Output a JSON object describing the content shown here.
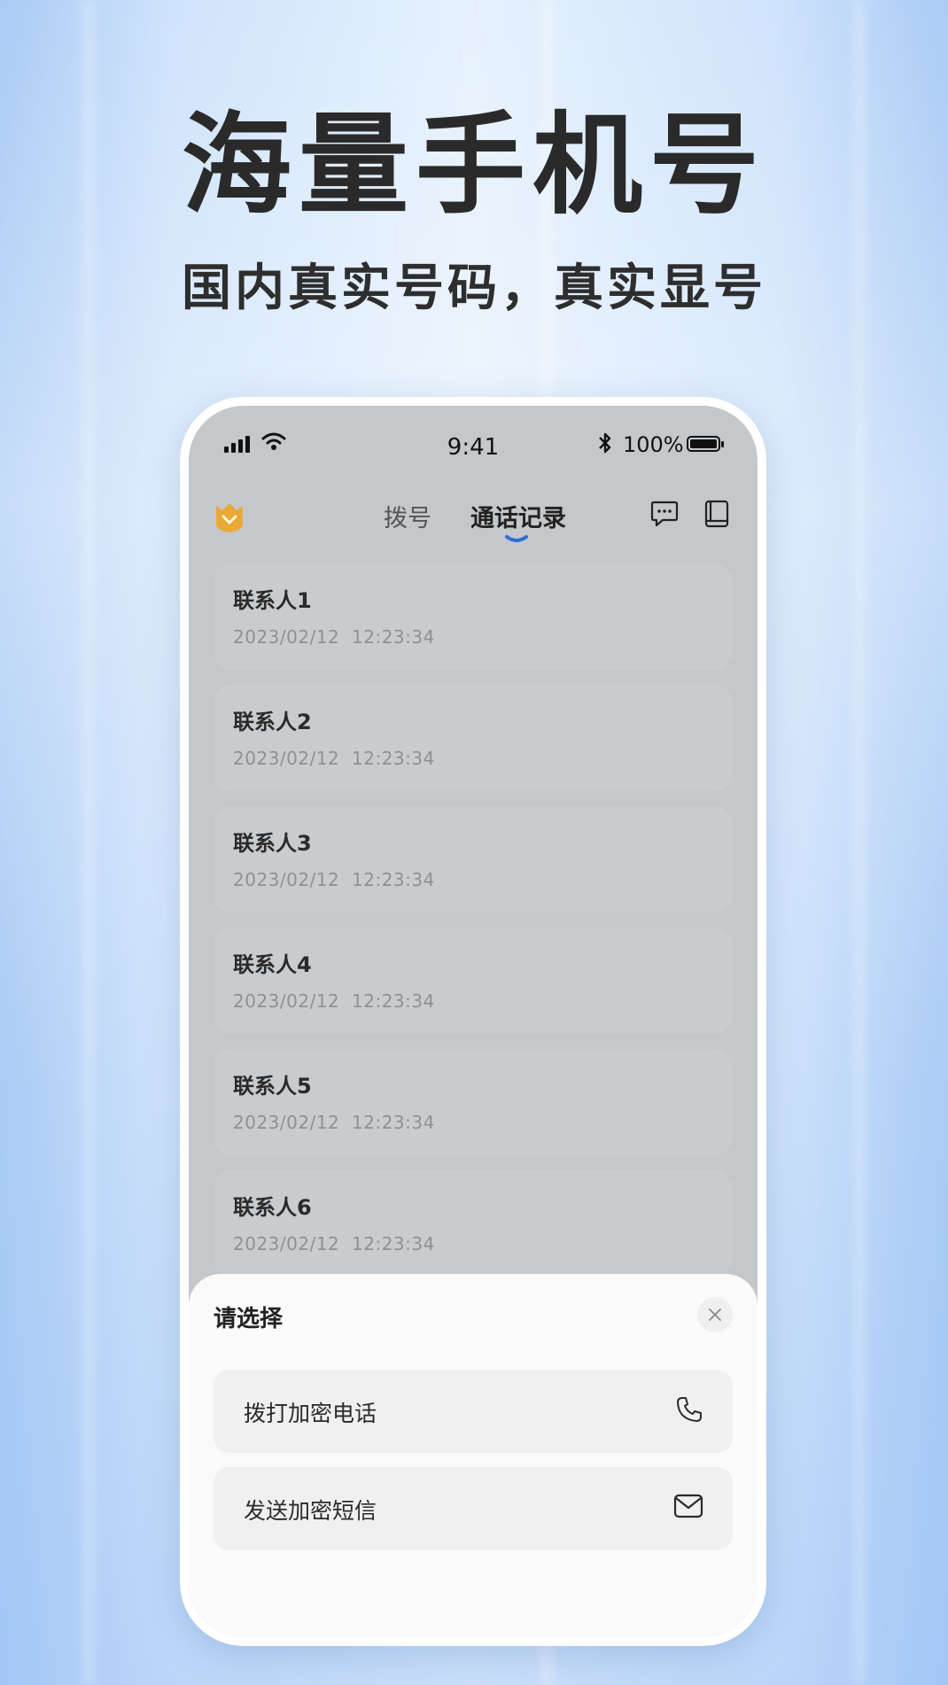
{
  "headline": "海量手机号",
  "subhead": "国内真实号码，真实显号",
  "status_bar": {
    "time": "9:41",
    "battery": "100%"
  },
  "nav": {
    "tabs": [
      {
        "label": "拨号",
        "active": false
      },
      {
        "label": "通话记录",
        "active": true
      }
    ],
    "icons": [
      "crest-badge-icon",
      "message-icon",
      "contacts-book-icon"
    ]
  },
  "call_log": [
    {
      "name": "联系人1",
      "date": "2023/02/12",
      "time": "12:23:34"
    },
    {
      "name": "联系人2",
      "date": "2023/02/12",
      "time": "12:23:34"
    },
    {
      "name": "联系人3",
      "date": "2023/02/12",
      "time": "12:23:34"
    },
    {
      "name": "联系人4",
      "date": "2023/02/12",
      "time": "12:23:34"
    },
    {
      "name": "联系人5",
      "date": "2023/02/12",
      "time": "12:23:34"
    },
    {
      "name": "联系人6",
      "date": "2023/02/12",
      "time": "12:23:34"
    }
  ],
  "sheet": {
    "title": "请选择",
    "options": [
      {
        "label": "拨打加密电话",
        "icon": "phone-icon"
      },
      {
        "label": "发送加密短信",
        "icon": "mail-icon"
      }
    ]
  },
  "colors": {
    "accent": "#2f6fd6",
    "crest": "#f0b23a"
  }
}
